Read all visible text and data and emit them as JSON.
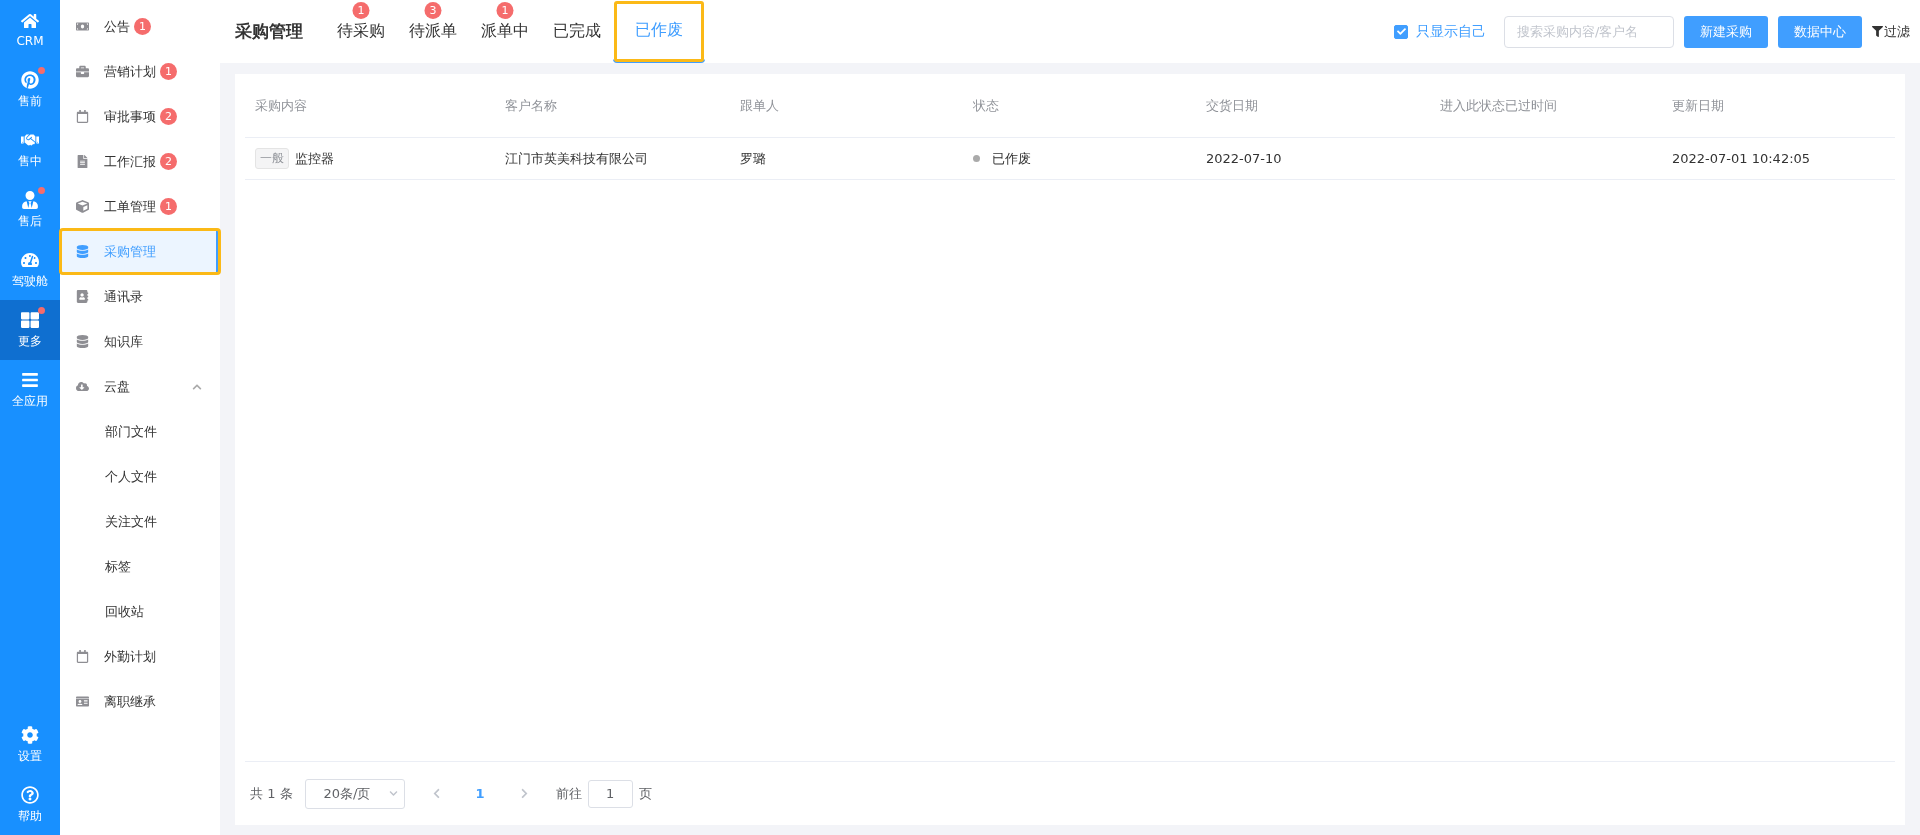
{
  "rail": {
    "items": [
      {
        "label": "CRM",
        "dot": false,
        "selected": false
      },
      {
        "label": "售前",
        "dot": true,
        "selected": false
      },
      {
        "label": "售中",
        "dot": false,
        "selected": false
      },
      {
        "label": "售后",
        "dot": true,
        "selected": false
      },
      {
        "label": "驾驶舱",
        "dot": false,
        "selected": false
      },
      {
        "label": "更多",
        "dot": true,
        "selected": true
      },
      {
        "label": "全应用",
        "dot": false,
        "selected": false
      }
    ],
    "footer": [
      {
        "label": "设置"
      },
      {
        "label": "帮助"
      }
    ]
  },
  "sidebar": {
    "items": [
      {
        "label": "公告",
        "badge": "1",
        "selected": false
      },
      {
        "label": "营销计划",
        "badge": "1",
        "selected": false
      },
      {
        "label": "审批事项",
        "badge": "2",
        "selected": false
      },
      {
        "label": "工作汇报",
        "badge": "2",
        "selected": false
      },
      {
        "label": "工单管理",
        "badge": "1",
        "selected": false
      },
      {
        "label": "采购管理",
        "selected": true
      },
      {
        "label": "通讯录",
        "selected": false
      },
      {
        "label": "知识库",
        "selected": false
      },
      {
        "label": "云盘",
        "selected": false,
        "expanded": true,
        "children": [
          {
            "label": "部门文件"
          },
          {
            "label": "个人文件"
          },
          {
            "label": "关注文件"
          },
          {
            "label": "标签"
          },
          {
            "label": "回收站"
          }
        ]
      },
      {
        "label": "外勤计划",
        "selected": false
      },
      {
        "label": "离职继承",
        "selected": false
      }
    ]
  },
  "header": {
    "title": "采购管理",
    "tabs": [
      {
        "label": "待采购",
        "badge": "1",
        "selected": false
      },
      {
        "label": "待派单",
        "badge": "3",
        "selected": false
      },
      {
        "label": "派单中",
        "badge": "1",
        "selected": false
      },
      {
        "label": "已完成",
        "selected": false
      },
      {
        "label": "已作废",
        "selected": true
      }
    ],
    "only_self": {
      "label": "只显示自己",
      "checked": true
    },
    "search": {
      "placeholder": "搜索采购内容/客户名"
    },
    "buttons": [
      "新建采购",
      "数据中心"
    ],
    "filter": "过滤"
  },
  "table": {
    "columns": [
      "采购内容",
      "客户名称",
      "跟单人",
      "状态",
      "交货日期",
      "进入此状态已过时间",
      "更新日期"
    ],
    "rows": [
      {
        "tag": "一般",
        "content": "监控器",
        "customer": "江门市英美科技有限公司",
        "owner": "罗璐",
        "status": "已作废",
        "delivery": "2022-07-10",
        "updated": "2022-07-01 10:42:05"
      }
    ]
  },
  "pagination": {
    "total": "共 1 条",
    "page_size": "20条/页",
    "pages": [
      {
        "label": "1",
        "selected": true
      }
    ],
    "goto_label": "前往",
    "goto_value": "1",
    "goto_suffix": "页"
  }
}
